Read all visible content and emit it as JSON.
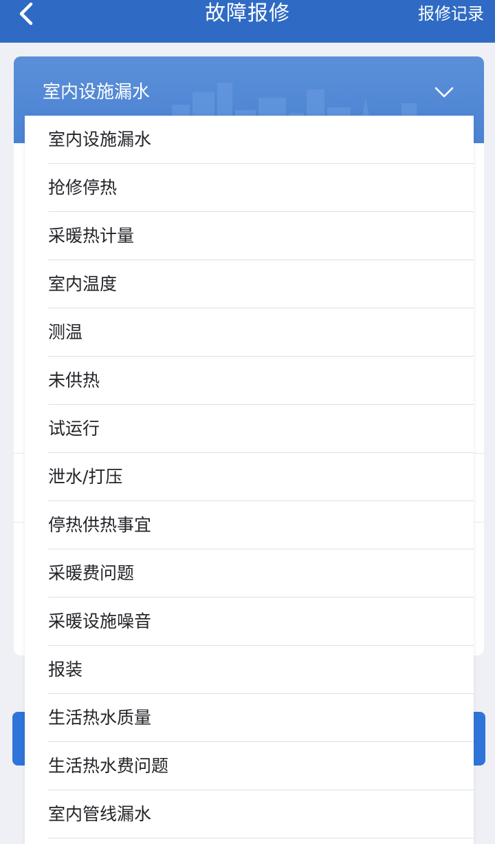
{
  "header": {
    "title": "故障报修",
    "records_label": "报修记录"
  },
  "form": {
    "selected_type": "室内设施漏水"
  },
  "dropdown": {
    "options": [
      "室内设施漏水",
      "抢修停热",
      "采暖热计量",
      "室内温度",
      "测温",
      "未供热",
      "试运行",
      "泄水/打压",
      "停热供热事宜",
      "采暖费问题",
      "采暖设施噪音",
      "报装",
      "生活热水质量",
      "生活热水费问题",
      "室内管线漏水"
    ]
  },
  "colors": {
    "header_bg": "#2f6bc4",
    "card_header_bg": "#4a82d2",
    "button_bg": "#2f74d8",
    "page_bg": "#eef0f5"
  },
  "icons": {
    "back": "chevron-left-icon",
    "expand": "chevron-down-icon"
  }
}
